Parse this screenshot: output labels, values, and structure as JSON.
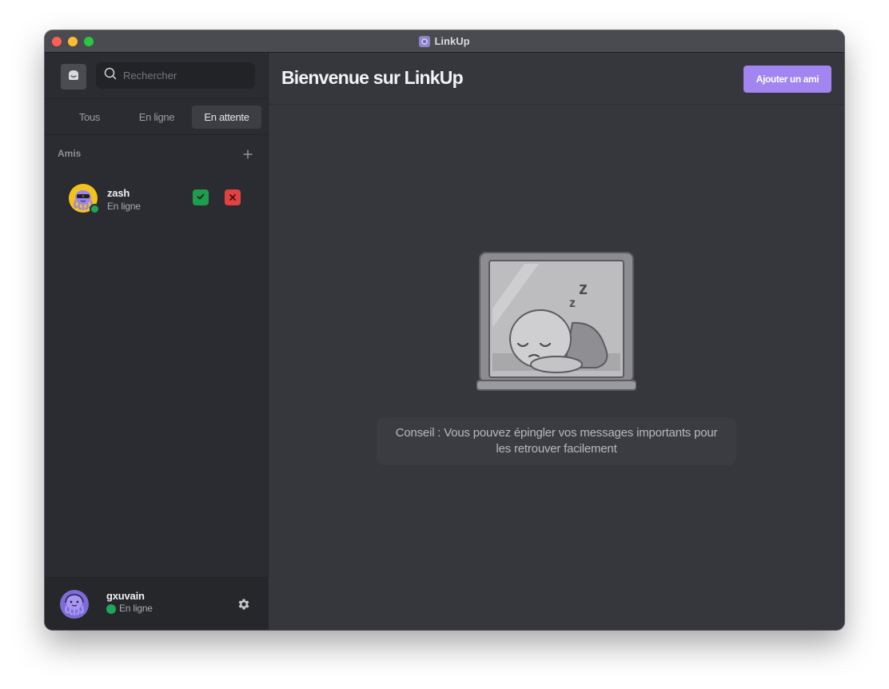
{
  "window": {
    "title": "LinkUp"
  },
  "sidebar": {
    "search_placeholder": "Rechercher",
    "tabs": [
      {
        "label": "Tous",
        "selected": false
      },
      {
        "label": "En ligne",
        "selected": false
      },
      {
        "label": "En attente",
        "selected": true
      }
    ],
    "section_title": "Amis",
    "friends": [
      {
        "name": "zash",
        "status": "En ligne",
        "online": true
      }
    ]
  },
  "user": {
    "name": "gxuvain",
    "status": "En ligne"
  },
  "main": {
    "title": "Bienvenue sur LinkUp",
    "add_friend_label": "Ajouter un ami",
    "tip": "Conseil : Vous pouvez épingler vos messages importants pour les retrouver facilement"
  },
  "colors": {
    "accent": "#a285f0",
    "online": "#1fa55a",
    "accept": "#1f9c4d",
    "decline": "#e24141"
  }
}
